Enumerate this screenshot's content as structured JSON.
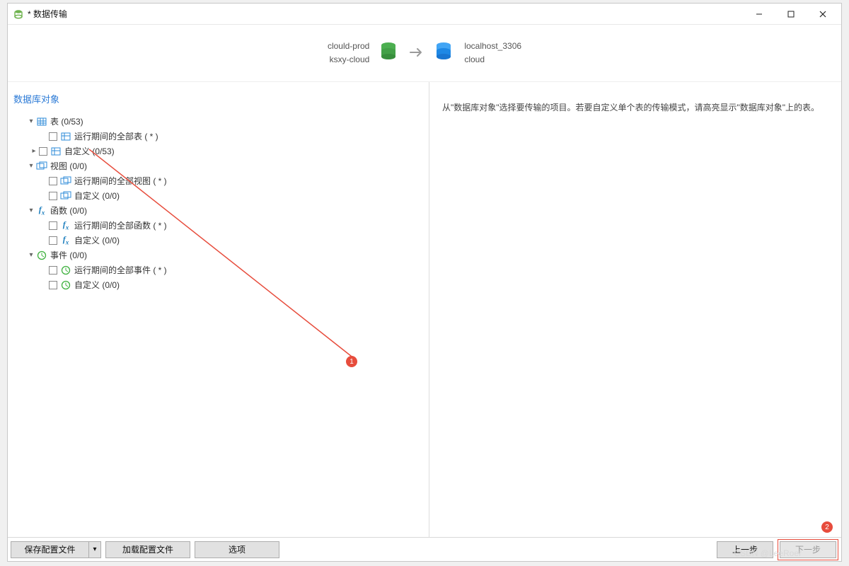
{
  "window": {
    "title": "* 数据传输"
  },
  "connection": {
    "source": {
      "name": "clould-prod",
      "schema": "ksxy-cloud"
    },
    "target": {
      "name": "localhost_3306",
      "schema": "cloud"
    }
  },
  "tree": {
    "section_title": "数据库对象",
    "tables": {
      "label": "表 (0/53)",
      "all": "运行期间的全部表 ( * )",
      "custom": "自定义 (0/53)"
    },
    "views": {
      "label": "视图 (0/0)",
      "all": "运行期间的全部视图 ( * )",
      "custom": "自定义 (0/0)"
    },
    "functions": {
      "label": "函数 (0/0)",
      "all": "运行期间的全部函数 ( * )",
      "custom": "自定义 (0/0)"
    },
    "events": {
      "label": "事件 (0/0)",
      "all": "运行期间的全部事件 ( * )",
      "custom": "自定义 (0/0)"
    }
  },
  "right_note": "从\"数据库对象\"选择要传输的项目。若要自定义单个表的传输模式，请高亮显示\"数据库对象\"上的表。",
  "footer": {
    "save_profile": "保存配置文件",
    "load_profile": "加载配置文件",
    "options": "选项",
    "prev": "上一步",
    "next": "下一步"
  },
  "annotations": {
    "badge1": "1",
    "badge2": "2"
  },
  "watermark": "CSDN @LeeRoer"
}
